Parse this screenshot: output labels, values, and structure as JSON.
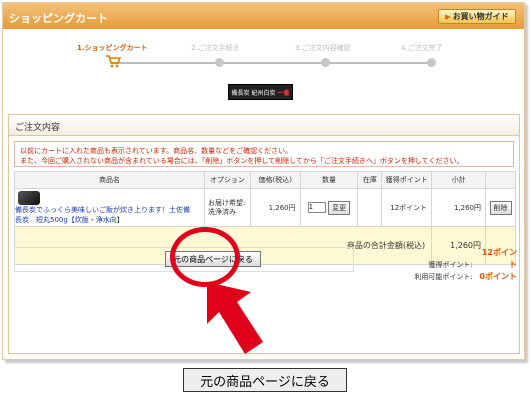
{
  "window": {
    "title": "ショッピングカート",
    "guide_button": "お買い物ガイド"
  },
  "steps": [
    {
      "label": "1.ショッピングカート"
    },
    {
      "label": "2.ご注文手続き"
    },
    {
      "label": "3.ご注文内容確認"
    },
    {
      "label": "4.ご注文完了"
    }
  ],
  "logo": {
    "text_a": "備長炭",
    "text_b": "紀州白炭",
    "text_c": "一番"
  },
  "section": {
    "title": "ご注文内容",
    "notice_line1": "以前にカートに入れた商品も表示されています。商品名、数量などをご確認ください。",
    "notice_line2": "また、今回ご購入されない商品が含まれている場合には、「削除」ボタンを押して削除してから「ご注文手続きへ」ボタンを押してください。"
  },
  "table": {
    "headers": [
      "商品名",
      "オプション",
      "価格(税込)",
      "数量",
      "在庫",
      "獲得ポイント",
      "小計"
    ],
    "row": {
      "name": "備長炭でふっくら美味しいご飯が炊き上ります！土佐備長炭　短丸500g【炊飯・浄水向】",
      "option": "お届け希望:洗浄済み",
      "price": "1,260円",
      "qty": "1",
      "change_button": "変更",
      "stock": "",
      "points": "12ポイント",
      "subtotal": "1,260円",
      "delete_button": "削除"
    },
    "total_label": "商品の合計金額(税込)",
    "total_value": "1,260円"
  },
  "back_button": "元の商品ページに戻る",
  "points": {
    "earned_label": "獲得ポイント:",
    "earned_value": "12ポイント",
    "available_label": "利用可能ポイント:",
    "available_value": "0ポイント"
  },
  "callout": "元の商品ページに戻る",
  "colors": {
    "accent": "#e79a3a",
    "annotation_red": "#e0001a",
    "link": "#1a3aa8"
  }
}
